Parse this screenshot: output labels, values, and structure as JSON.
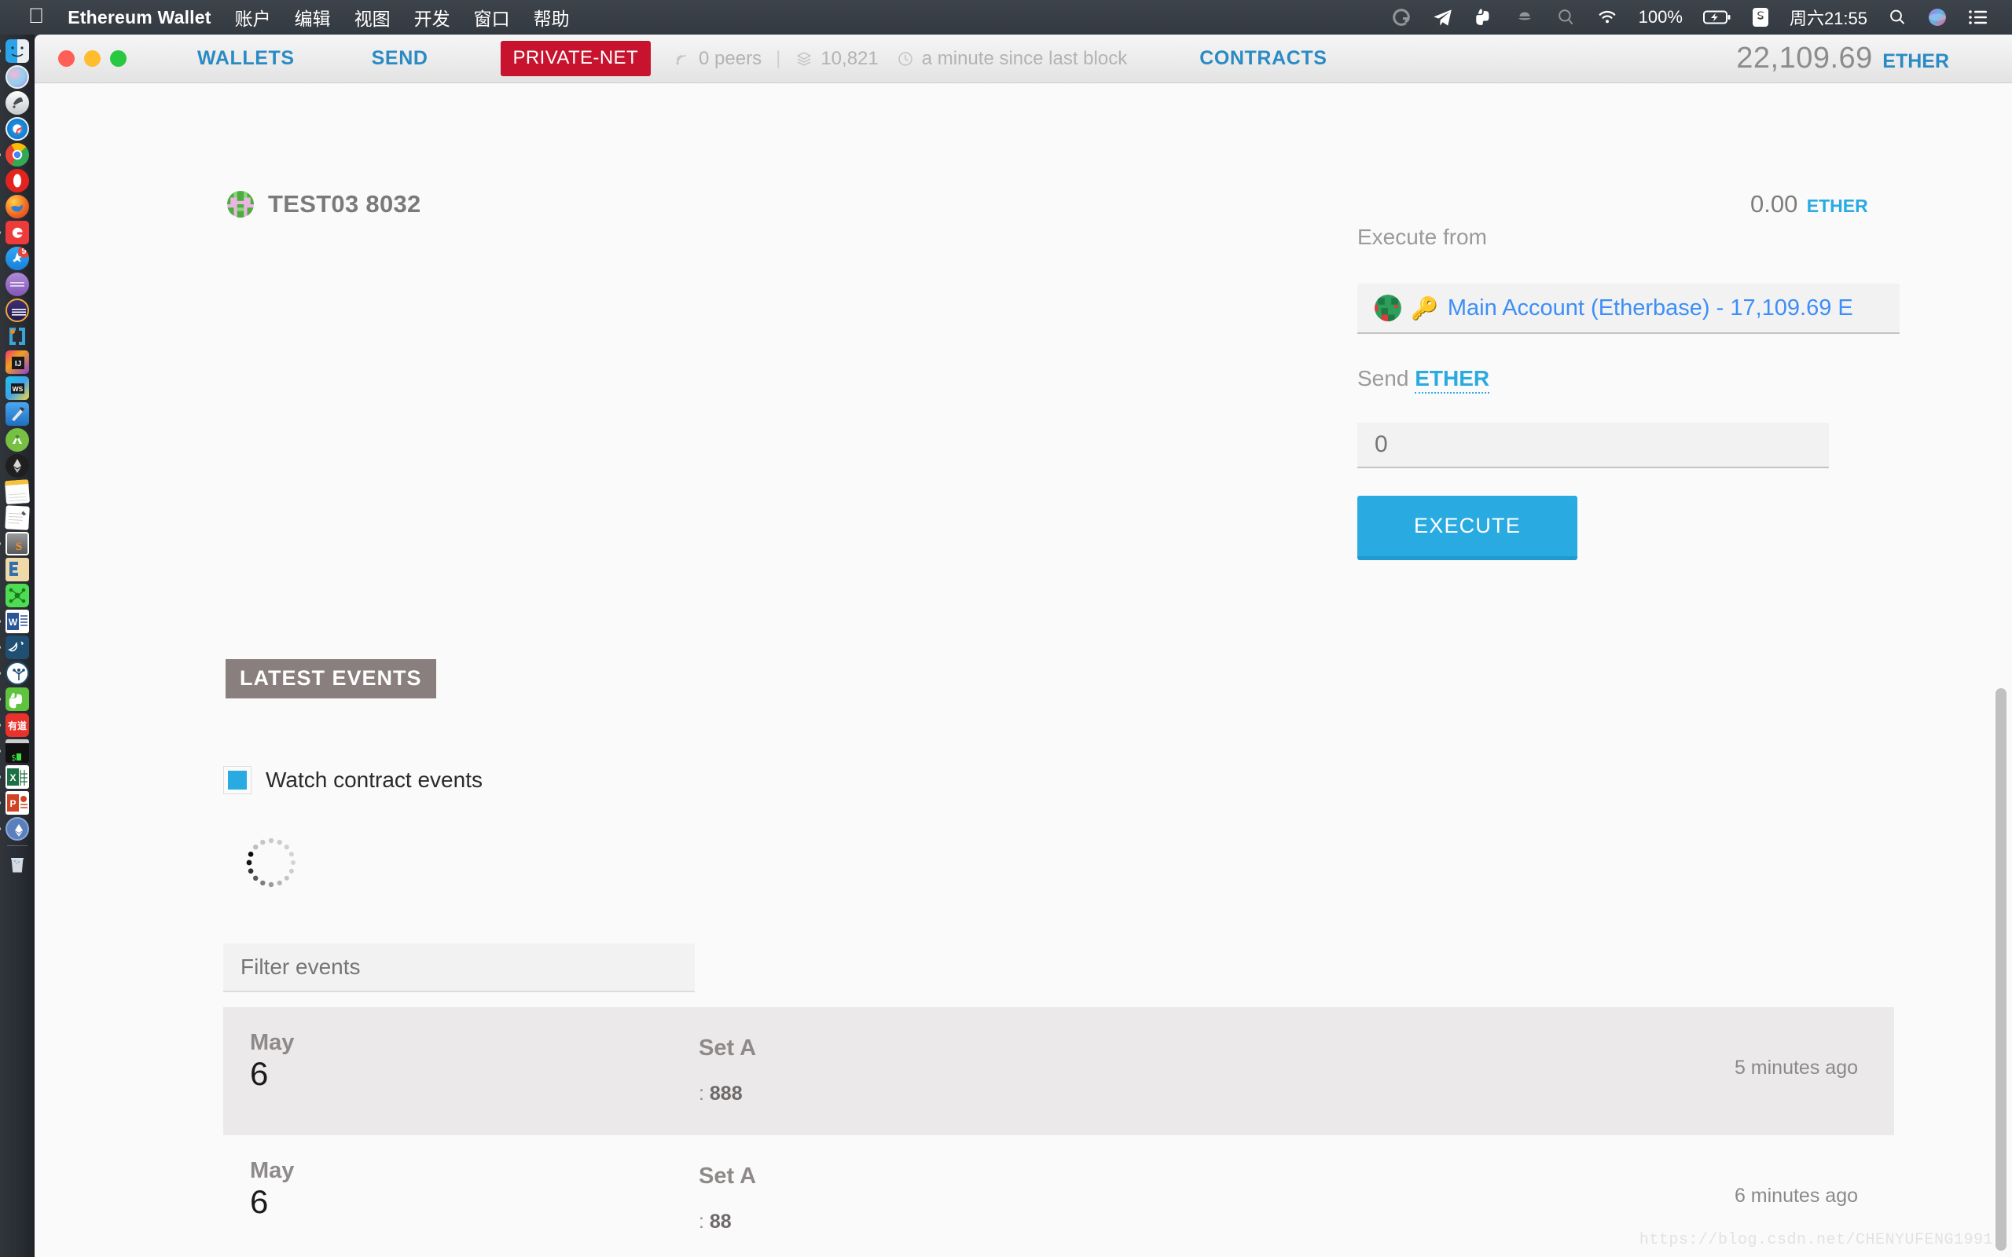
{
  "menubar": {
    "apple": "",
    "app_title": "Ethereum Wallet",
    "items": [
      "账户",
      "编辑",
      "视图",
      "开发",
      "窗口",
      "帮助"
    ],
    "battery": "100%",
    "clock": "周六21:55",
    "icons": [
      "grammarly-icon",
      "telegram-icon",
      "evernote-icon",
      "dropbox-icon",
      "spotlight-loupe-icon",
      "wifi-icon",
      "battery-icon",
      "sogou-input-icon",
      "search-icon",
      "siri-icon",
      "notification-center-icon"
    ]
  },
  "dock": {
    "items": [
      {
        "name": "finder",
        "running": true
      },
      {
        "name": "siri",
        "running": false
      },
      {
        "name": "launchpad",
        "running": false
      },
      {
        "name": "safari",
        "running": false
      },
      {
        "name": "chrome",
        "running": true
      },
      {
        "name": "opera",
        "running": false
      },
      {
        "name": "firefox",
        "running": false
      },
      {
        "name": "gitter",
        "running": true
      },
      {
        "name": "app-store",
        "running": false,
        "badge": "9"
      },
      {
        "name": "ulysses",
        "running": false
      },
      {
        "name": "iterm",
        "running": false
      },
      {
        "name": "jetbrains-toolbox",
        "running": false
      },
      {
        "name": "intellij-idea",
        "running": false
      },
      {
        "name": "webstorm",
        "running": false
      },
      {
        "name": "xcode",
        "running": false
      },
      {
        "name": "android-studio",
        "running": false
      },
      {
        "name": "mist",
        "running": false
      },
      {
        "name": "notes",
        "running": false
      },
      {
        "name": "pages",
        "running": false
      },
      {
        "name": "sublime-text",
        "running": true
      },
      {
        "name": "eclipse",
        "running": false
      },
      {
        "name": "graph-tool",
        "running": false
      },
      {
        "name": "word",
        "running": true
      },
      {
        "name": "mysql-workbench",
        "running": true
      },
      {
        "name": "sourcetree",
        "running": true
      },
      {
        "name": "evernote",
        "running": true
      },
      {
        "name": "youdao-dict",
        "running": true
      },
      {
        "name": "terminal",
        "running": true
      },
      {
        "name": "excel",
        "running": true
      },
      {
        "name": "powerpoint",
        "running": true
      },
      {
        "name": "ethereum-wallet",
        "running": true
      },
      {
        "name": "trash",
        "running": false
      }
    ]
  },
  "window": {
    "nav": {
      "wallets": "WALLETS",
      "send": "SEND",
      "network": "PRIVATE-NET",
      "contracts": "CONTRACTS"
    },
    "status": {
      "peers": "0 peers",
      "block": "10,821",
      "last_block": "a minute since last block"
    },
    "balance": {
      "amount": "22,109.69",
      "unit": "ETHER"
    }
  },
  "contract": {
    "name": "TEST03 8032",
    "balance": {
      "amount": "0.00",
      "unit": "ETHER"
    }
  },
  "execute": {
    "from_label": "Execute from",
    "from_account": "Main Account (Etherbase) - 17,109.69 E",
    "send_label": "Send",
    "send_currency": "ETHER",
    "amount_placeholder": "0",
    "amount_value": "",
    "button": "EXECUTE"
  },
  "events_section": {
    "title": "LATEST EVENTS",
    "watch_label": "Watch contract events",
    "watch_checked": true,
    "filter_placeholder": "Filter events",
    "filter_value": "",
    "rows": [
      {
        "month": "May",
        "day": "6",
        "name": "Set A",
        "args": ": 888",
        "args_value": "888",
        "ago": "5 minutes ago"
      },
      {
        "month": "May",
        "day": "6",
        "name": "Set A",
        "args": ": 88",
        "args_value": "88",
        "ago": "6 minutes ago"
      }
    ]
  },
  "watermark": "https://blog.csdn.net/CHENYUFENG1991",
  "colors": {
    "accent_blue": "#29abe2",
    "link_blue": "#2a8bc4",
    "network_red": "#c7132e",
    "section_gray": "#8a7f7f"
  }
}
